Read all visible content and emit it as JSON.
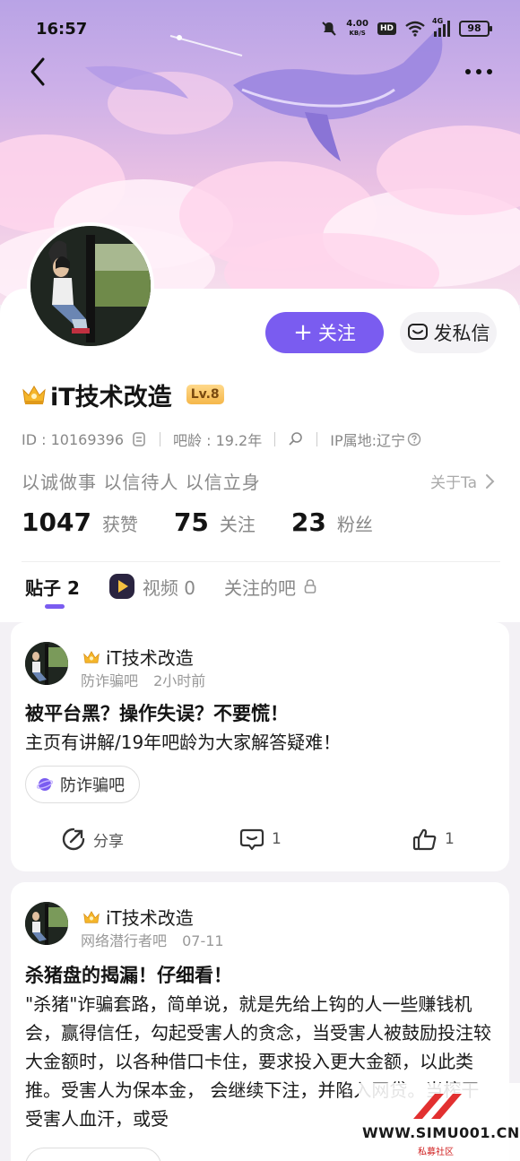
{
  "status_bar": {
    "time": "16:57",
    "net_speed_value": "4.00",
    "net_speed_unit": "KB/S",
    "hd_label": "HD",
    "network_type": "4G",
    "battery": "98"
  },
  "profile": {
    "username": "iT技术改造",
    "level": "Lv.8",
    "follow_label": "关注",
    "message_label": "发私信",
    "id_text": "ID : 10169396",
    "bar_age_text": "吧龄 : 19.2年",
    "ip_text": "IP属地:辽宁",
    "motto": "以诚做事  以信待人  以信立身",
    "about_label": "关于Ta",
    "stats": [
      {
        "value": "1047",
        "label": "获赞"
      },
      {
        "value": "75",
        "label": "关注"
      },
      {
        "value": "23",
        "label": "粉丝"
      }
    ]
  },
  "tabs": [
    {
      "label": "贴子 2"
    },
    {
      "label": "视频 0"
    },
    {
      "label": "关注的吧"
    }
  ],
  "posts": [
    {
      "author": "iT技术改造",
      "forum": "防诈骗吧",
      "time": "2小时前",
      "title": "被平台黑？操作失误？不要慌！",
      "body": "主页有讲解/19年吧龄为大家解答疑难！",
      "chip": "防诈骗吧",
      "share_label": "分享",
      "comment_count": "1",
      "like_count": "1"
    },
    {
      "author": "iT技术改造",
      "forum": "网络潜行者吧",
      "time": "07-11",
      "title": "杀猪盘的揭漏！仔细看！",
      "body": "\"杀猪\"诈骗套路，简单说，就是先给上钩的人一些赚钱机会，赢得信任，勾起受害人的贪念，当受害人被鼓励投注较大金额时，以各种借口卡住，要求投入更大金额，以此类推。受害人为保本金，    会继续下注，并陷入网贷。当榨干受害人血汗，或受"
    }
  ],
  "watermark": {
    "text": "WWW.SIMU001.CN",
    "sub": "私募社区"
  },
  "colors": {
    "accent": "#7a5cf0",
    "level_badge": "#f5b74a"
  }
}
